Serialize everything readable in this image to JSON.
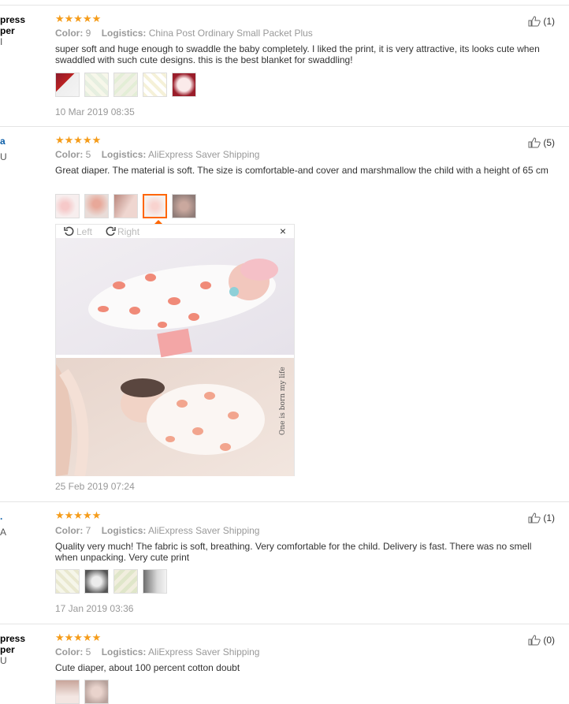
{
  "reviews": [
    {
      "user_line1": "press",
      "user_line2": "per",
      "user_line3": "I",
      "color_label": "Color:",
      "color_value": "9",
      "logistics_label": "Logistics:",
      "logistics_value": "China Post Ordinary Small Packet Plus",
      "text": "super soft and huge enough to swaddle the baby completely. I liked the print, it is very attractive, its looks cute when swaddled with such cute designs. this is the best blanket for swaddling!",
      "date": "10 Mar 2019 08:35",
      "likes": "(1)"
    },
    {
      "user_line1": "a",
      "user_line2": "",
      "user_line3": "U",
      "color_label": "Color:",
      "color_value": "5",
      "logistics_label": "Logistics:",
      "logistics_value": "AliExpress Saver Shipping",
      "text": "Great diaper. The material is soft. The size is comfortable-and cover and marshmallow the child with a height of 65 cm",
      "date": "25 Feb 2019 07:24",
      "likes": "(5)"
    },
    {
      "user_line1": ".",
      "user_line2": "",
      "user_line3": "A",
      "color_label": "Color:",
      "color_value": "7",
      "logistics_label": "Logistics:",
      "logistics_value": "AliExpress Saver Shipping",
      "text": "Quality very much! The fabric is soft, breathing. Very comfortable for the child. Delivery is fast. There was no smell when unpacking. Very cute print",
      "date": "17 Jan 2019 03:36",
      "likes": "(1)"
    },
    {
      "user_line1": "press",
      "user_line2": "per",
      "user_line3": "U",
      "color_label": "Color:",
      "color_value": "5",
      "logistics_label": "Logistics:",
      "logistics_value": "AliExpress Saver Shipping",
      "text": "Cute diaper, about 100 percent cotton doubt",
      "date": "",
      "likes": "(0)"
    }
  ],
  "stars": "★★★★★",
  "viewer": {
    "left_label": "Left",
    "right_label": "Right",
    "close_label": "×",
    "photo_caption": "One is born my life"
  },
  "colors": {
    "star": "#f59c1a",
    "active_thumb_border": "#ff6600",
    "link": "#0b5ea8"
  }
}
